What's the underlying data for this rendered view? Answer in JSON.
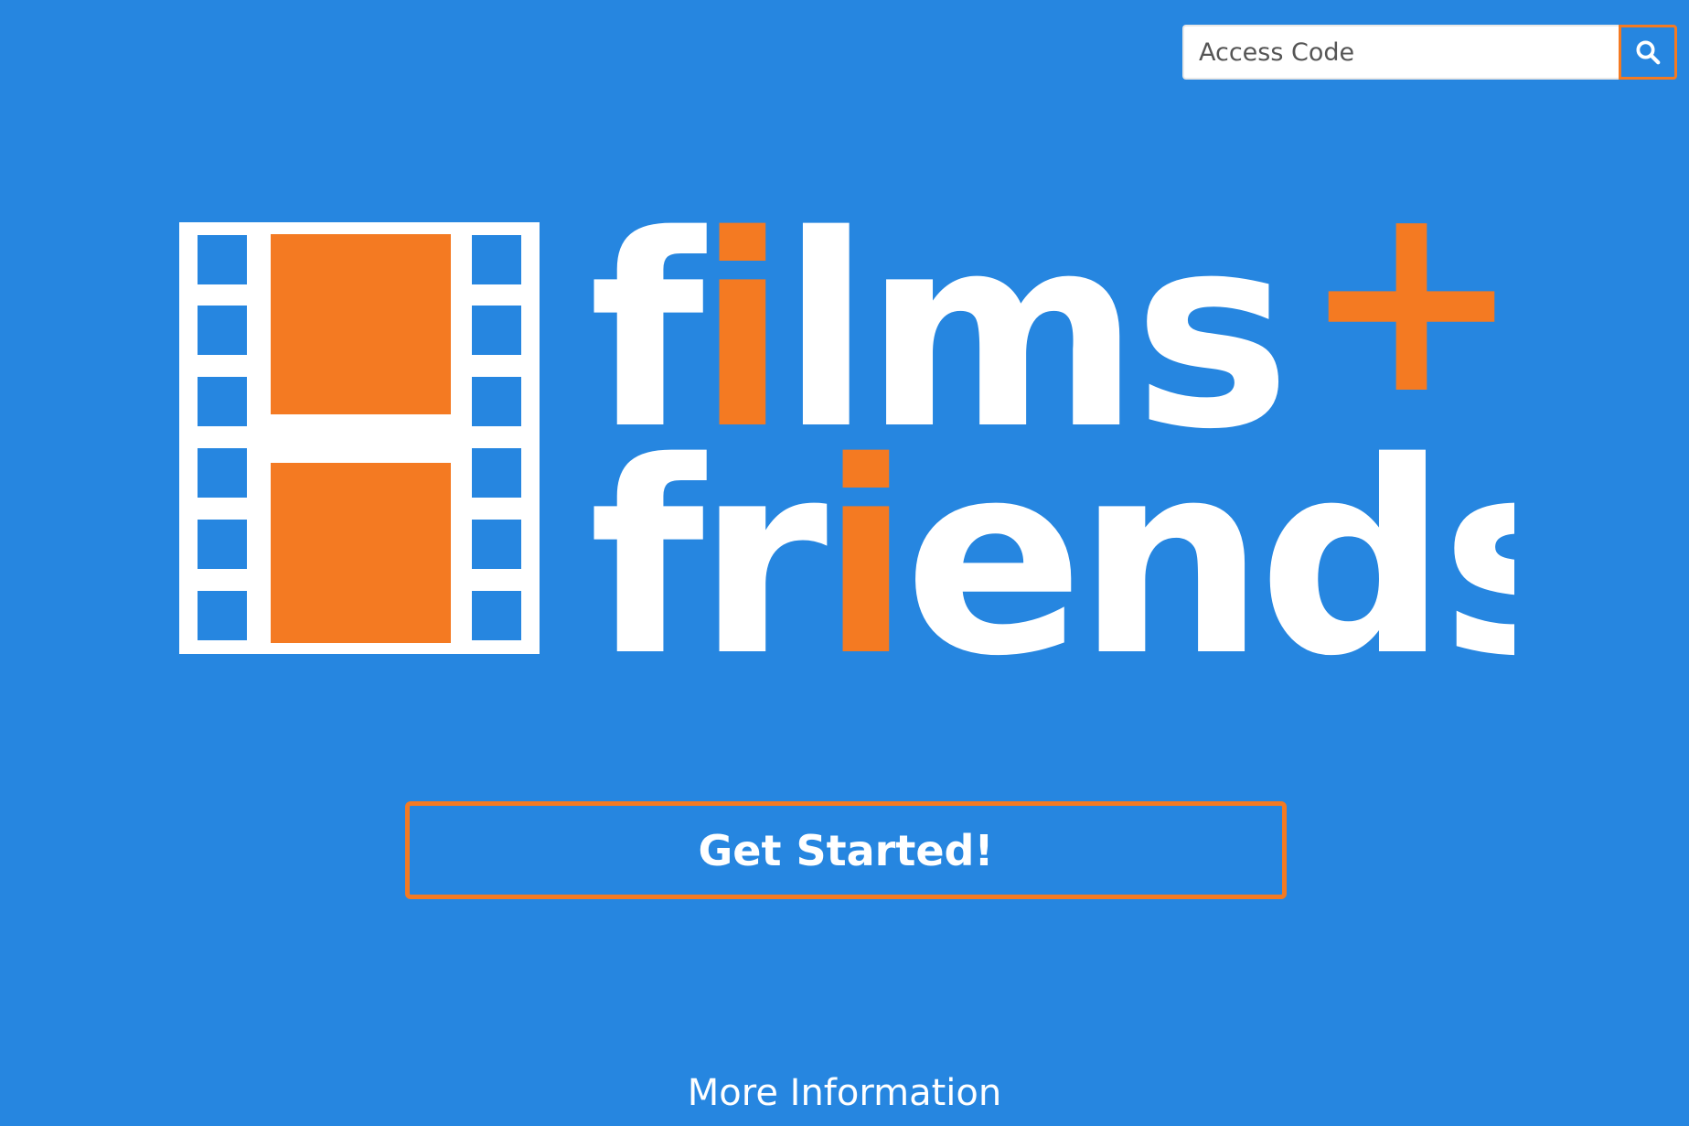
{
  "access": {
    "placeholder": "Access Code",
    "search_icon": "search-icon"
  },
  "logo": {
    "line1_a": "f",
    "line1_i": "i",
    "line1_b": "lms",
    "plus": "+",
    "line2_a": "fr",
    "line2_i": "i",
    "line2_b": "ends",
    "icon": "film-strip-icon"
  },
  "cta": {
    "label": "Get Started!"
  },
  "footer": {
    "more_info": "More Information"
  },
  "colors": {
    "background": "#2686E0",
    "accent": "#F47A22",
    "white": "#FFFFFF"
  }
}
